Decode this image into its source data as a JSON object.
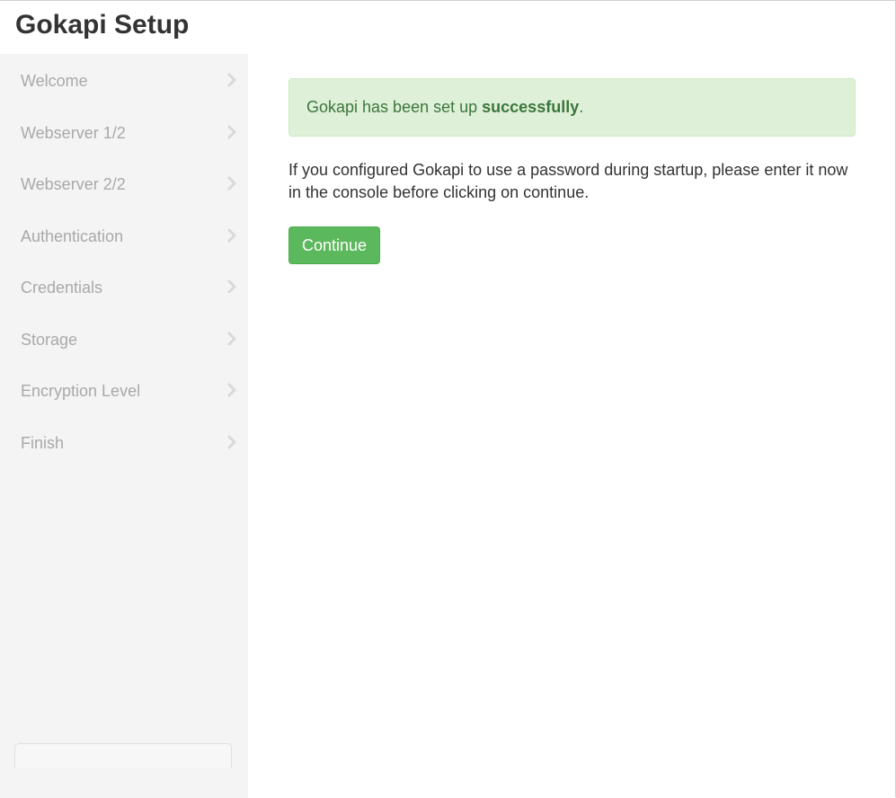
{
  "header": {
    "title": "Gokapi Setup"
  },
  "sidebar": {
    "steps": [
      {
        "label": "Welcome"
      },
      {
        "label": "Webserver 1/2"
      },
      {
        "label": "Webserver 2/2"
      },
      {
        "label": "Authentication"
      },
      {
        "label": "Credentials"
      },
      {
        "label": "Storage"
      },
      {
        "label": "Encryption Level"
      },
      {
        "label": "Finish"
      }
    ],
    "step_icon": "chevron-right-icon"
  },
  "main": {
    "alert": {
      "text_before": "Gokapi has been set up ",
      "text_bold": "successfully",
      "text_after": "."
    },
    "info": "If you configured Gokapi to use a password during startup, please enter it now in the console before clicking on continue.",
    "continue_label": "Continue"
  },
  "colors": {
    "sidebar_bg": "#f4f4f4",
    "step_text": "#a9a9a9",
    "alert_bg": "#dff0d8",
    "alert_text": "#3c763d",
    "button_bg": "#5cb85c",
    "button_text": "#ffffff"
  }
}
